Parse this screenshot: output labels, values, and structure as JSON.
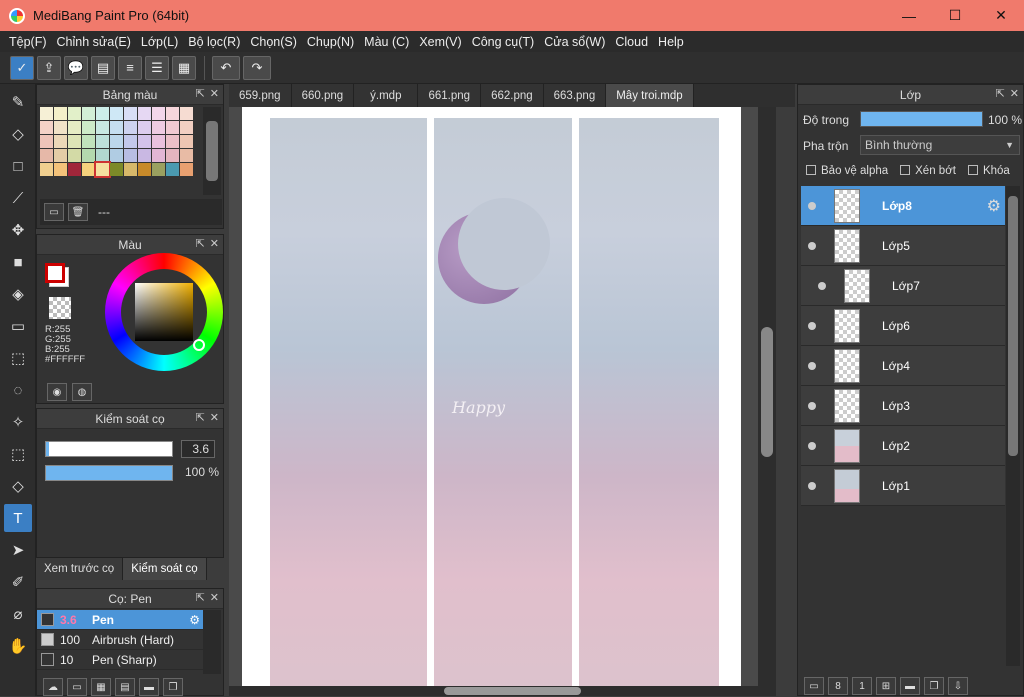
{
  "window": {
    "title": "MediBang Paint Pro (64bit)",
    "minimize": "—",
    "maximize": "☐",
    "close": "✕"
  },
  "menu": [
    "Tệp(F)",
    "Chỉnh sửa(E)",
    "Lớp(L)",
    "Bộ lọc(R)",
    "Chọn(S)",
    "Chụp(N)",
    "Màu (C)",
    "Xem(V)",
    "Công cụ(T)",
    "Cửa sổ(W)",
    "Cloud",
    "Help"
  ],
  "palette": {
    "title": "Bảng màu",
    "label": "---"
  },
  "color": {
    "title": "Màu",
    "r": "R:255",
    "g": "G:255",
    "b": "B:255",
    "hex": "#FFFFFF"
  },
  "brush_control": {
    "title": "Kiểm soát cọ",
    "size": "3.6",
    "opacity": "100 %",
    "opacity_level": 1.0,
    "size_level": 0.02
  },
  "tabs": {
    "preview": "Xem trước cọ",
    "control": "Kiểm soát cọ"
  },
  "brushes": {
    "title": "Cọ: Pen",
    "items": [
      {
        "size": "3.6",
        "name": "Pen",
        "color": "#333333"
      },
      {
        "size": "100",
        "name": "Airbrush (Hard)",
        "color": "#cccccc"
      },
      {
        "size": "10",
        "name": "Pen (Sharp)",
        "color": "#333333"
      }
    ]
  },
  "doc_tabs": [
    "659.png",
    "660.png",
    "ý.mdp",
    "661.png",
    "662.png",
    "663.png",
    "Mây troi.mdp"
  ],
  "layers_panel": {
    "title": "Lớp",
    "opacity_label": "Độ trong",
    "opacity_value": "100 %",
    "opacity_level": 1.0,
    "blend_label": "Pha trộn",
    "blend_value": "Bình thường",
    "protect_alpha": "Bảo vệ alpha",
    "clip": "Xén bớt",
    "lock": "Khóa"
  },
  "layers": [
    "Lớp8",
    "Lớp5",
    "Lớp7",
    "Lớp6",
    "Lớp4",
    "Lớp3",
    "Lớp2",
    "Lớp1"
  ],
  "canvas_text": {
    "happy": "Happy"
  },
  "colors": {
    "accent": "#4c95d8",
    "titlebar": "#f07a6c"
  }
}
